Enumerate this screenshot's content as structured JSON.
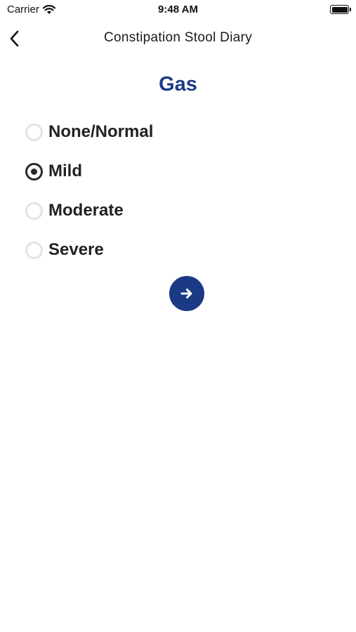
{
  "status_bar": {
    "carrier": "Carrier",
    "time": "9:48 AM",
    "battery_level": 1.0
  },
  "nav": {
    "back_icon": "chevron-left-icon",
    "title": "Constipation Stool Diary"
  },
  "question": {
    "title": "Gas",
    "options": [
      {
        "label": "None/Normal",
        "selected": false
      },
      {
        "label": "Mild",
        "selected": true
      },
      {
        "label": "Moderate",
        "selected": false
      },
      {
        "label": "Severe",
        "selected": false
      }
    ]
  },
  "next_button": {
    "icon": "arrow-right-icon"
  },
  "colors": {
    "accent": "#1b3a86",
    "radio_unselected": "#e3e3e3",
    "radio_selected": "#2a2a2a"
  }
}
